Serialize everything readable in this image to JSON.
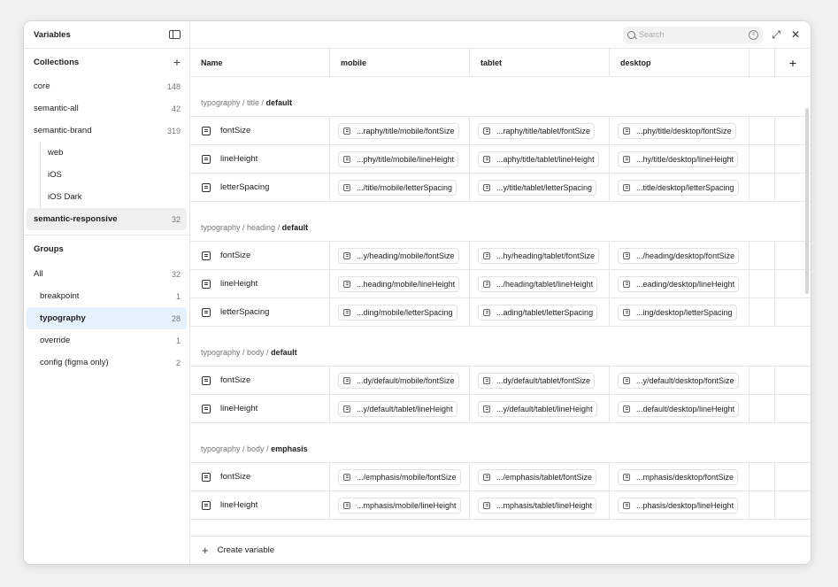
{
  "sidebar": {
    "title": "Variables",
    "collections_label": "Collections",
    "collections": [
      {
        "label": "core",
        "count": "148"
      },
      {
        "label": "semantic-all",
        "count": "42"
      },
      {
        "label": "semantic-brand",
        "count": "319"
      },
      {
        "label": "web",
        "count": ""
      },
      {
        "label": "iOS",
        "count": ""
      },
      {
        "label": "iOS Dark",
        "count": ""
      },
      {
        "label": "semantic-responsive",
        "count": "32"
      }
    ],
    "groups_label": "Groups",
    "groups": [
      {
        "label": "All",
        "count": "32"
      },
      {
        "label": "breakpoint",
        "count": "1"
      },
      {
        "label": "typography",
        "count": "28"
      },
      {
        "label": "override",
        "count": "1"
      },
      {
        "label": "config (figma only)",
        "count": "2"
      }
    ]
  },
  "search": {
    "placeholder": "Search",
    "value": ""
  },
  "columns": {
    "name": "Name",
    "mobile": "mobile",
    "tablet": "tablet",
    "desktop": "desktop",
    "add": "+"
  },
  "groups": [
    {
      "path": "typography / title / ",
      "leaf": "default",
      "rows": [
        {
          "name": "fontSize",
          "mobile": "...raphy/title/mobile/fontSize",
          "tablet": "...raphy/title/tablet/fontSize",
          "desktop": "...phy/title/desktop/fontSize"
        },
        {
          "name": "lineHeight",
          "mobile": "...phy/title/mobile/lineHeight",
          "tablet": "...aphy/title/tablet/lineHeight",
          "desktop": "...hy/title/desktop/lineHeight"
        },
        {
          "name": "letterSpacing",
          "mobile": ".../title/mobile/letterSpacing",
          "tablet": "...y/title/tablet/letterSpacing",
          "desktop": "...title/desktop/letterSpacing"
        }
      ]
    },
    {
      "path": "typography / heading / ",
      "leaf": "default",
      "rows": [
        {
          "name": "fontSize",
          "mobile": "...y/heading/mobile/fontSize",
          "tablet": "...hy/heading/tablet/fontSize",
          "desktop": ".../heading/desktop/fontSize"
        },
        {
          "name": "lineHeight",
          "mobile": "...heading/mobile/lineHeight",
          "tablet": ".../heading/tablet/lineHeight",
          "desktop": "...eading/desktop/lineHeight"
        },
        {
          "name": "letterSpacing",
          "mobile": "...ding/mobile/letterSpacing",
          "tablet": "...ading/tablet/letterSpacing",
          "desktop": "...ing/desktop/letterSpacing"
        }
      ]
    },
    {
      "path": "typography / body / ",
      "leaf": "default",
      "rows": [
        {
          "name": "fontSize",
          "mobile": "...dy/default/mobile/fontSize",
          "tablet": "...dy/default/tablet/fontSize",
          "desktop": "...y/default/desktop/fontSize"
        },
        {
          "name": "lineHeight",
          "mobile": "...y/default/tablet/lineHeight",
          "tablet": "...y/default/tablet/lineHeight",
          "desktop": "...default/desktop/lineHeight"
        }
      ]
    },
    {
      "path": "typography / body / ",
      "leaf": "emphasis",
      "rows": [
        {
          "name": "fontSize",
          "mobile": ".../emphasis/mobile/fontSize",
          "tablet": ".../emphasis/tablet/fontSize",
          "desktop": "...mphasis/desktop/fontSize"
        },
        {
          "name": "lineHeight",
          "mobile": "...mphasis/mobile/lineHeight",
          "tablet": "...mphasis/tablet/lineHeight",
          "desktop": "...phasis/desktop/lineHeight"
        }
      ]
    }
  ],
  "footer": {
    "create_label": "Create variable"
  }
}
